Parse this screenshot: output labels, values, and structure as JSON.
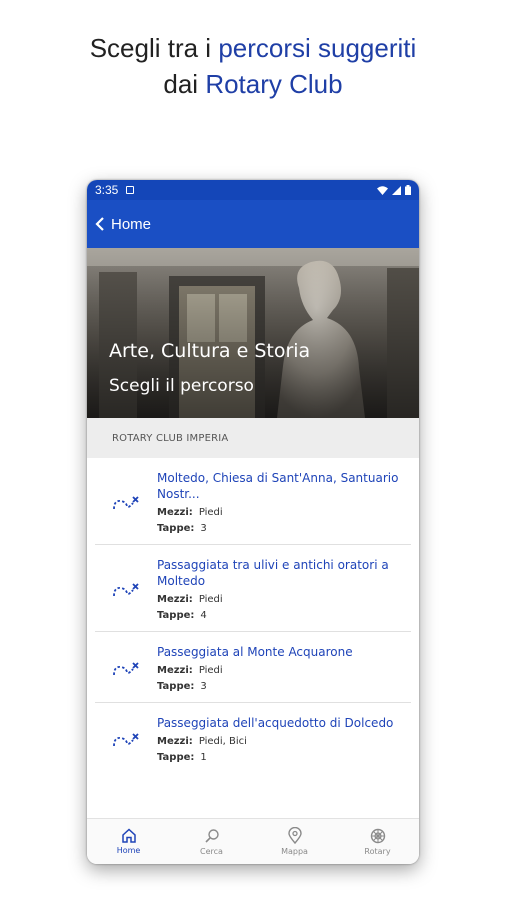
{
  "headline": {
    "line1_pre": "Scegli tra i ",
    "line1_hl": "percorsi suggeriti",
    "line2_pre": "dai ",
    "line2_hl": "Rotary Club"
  },
  "status": {
    "time": "3:35"
  },
  "appbar": {
    "back_label": "Home"
  },
  "hero": {
    "title": "Arte, Cultura e Storia",
    "subtitle": "Scegli il percorso"
  },
  "section": {
    "title": "ROTARY CLUB IMPERIA"
  },
  "routes": [
    {
      "title": "Moltedo, Chiesa di Sant'Anna, Santuario Nostr...",
      "mezzi_label": "Mezzi:",
      "mezzi": "Piedi",
      "tappe_label": "Tappe:",
      "tappe": "3"
    },
    {
      "title": "Passaggiata tra ulivi e antichi oratori a Moltedo",
      "mezzi_label": "Mezzi:",
      "mezzi": "Piedi",
      "tappe_label": "Tappe:",
      "tappe": "4"
    },
    {
      "title": "Passeggiata al Monte Acquarone",
      "mezzi_label": "Mezzi:",
      "mezzi": "Piedi",
      "tappe_label": "Tappe:",
      "tappe": "3"
    },
    {
      "title": "Passeggiata dell'acquedotto di Dolcedo",
      "mezzi_label": "Mezzi:",
      "mezzi": "Piedi, Bici",
      "tappe_label": "Tappe:",
      "tappe": "1"
    }
  ],
  "tabs": [
    {
      "label": "Home",
      "icon": "home-icon"
    },
    {
      "label": "Cerca",
      "icon": "search-icon"
    },
    {
      "label": "Mappa",
      "icon": "map-pin-icon"
    },
    {
      "label": "Rotary",
      "icon": "rotary-wheel-icon"
    }
  ],
  "colors": {
    "accent": "#1a4fc4",
    "link": "#1f44b8",
    "statusbar": "#1446b8"
  }
}
